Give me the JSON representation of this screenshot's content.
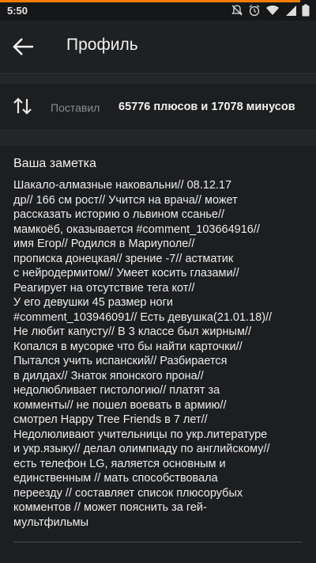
{
  "status_bar": {
    "time": "5:50",
    "accent_color": "#f57c00",
    "icons": [
      "mute-icon",
      "alarm-icon",
      "wifi-icon",
      "signal-icon",
      "battery-icon"
    ]
  },
  "header": {
    "back_icon": "arrow-left-icon",
    "title": "Профиль"
  },
  "stats": {
    "icon": "sort-arrows-icon",
    "label": "Поставил",
    "value": "65776 плюсов и 17078 минусов"
  },
  "note": {
    "title": "Ваша заметка",
    "lines": [
      "Шакало-алмазные наковальни// 08.12.17",
      "др// 166 см рост// Учится на врача// может",
      "рассказать историю о львином ссанье//",
      "мамкоёб, оказывается #comment_103664916//",
      "имя Егор// Родился в Мариуполе//",
      "прописка донецкая// зрение -7// астматик",
      "с нейродермитом// Умеет косить глазами//",
      "Реагирует на отсутствие тега кот//",
      "У его девушки 45 размер ноги",
      "#comment_103946091// Есть девушка(21.01.18)//",
      "Не любит капусту// В 3 классе был жирным//",
      "Копался в мусорке что бы найти карточки//",
      "Пытался учить испанский// Разбирается",
      "в дилдах// Знаток японского прона//",
      "недолюбливает гистологию// платят за",
      "комменты// не пошел воевать в армию//",
      "смотрел Happy Tree Friends в 7 лет//",
      "Недолюливают учительницы по укр.литературе",
      "и укр.языку// делал олимпиаду по английскому//",
      "есть телефон LG, яаляется основным и",
      "единственным // мать способствовала",
      "переезду // составляет список плюсорубых",
      "комментов // может пояснить за гей-",
      "мультфильмы"
    ]
  }
}
